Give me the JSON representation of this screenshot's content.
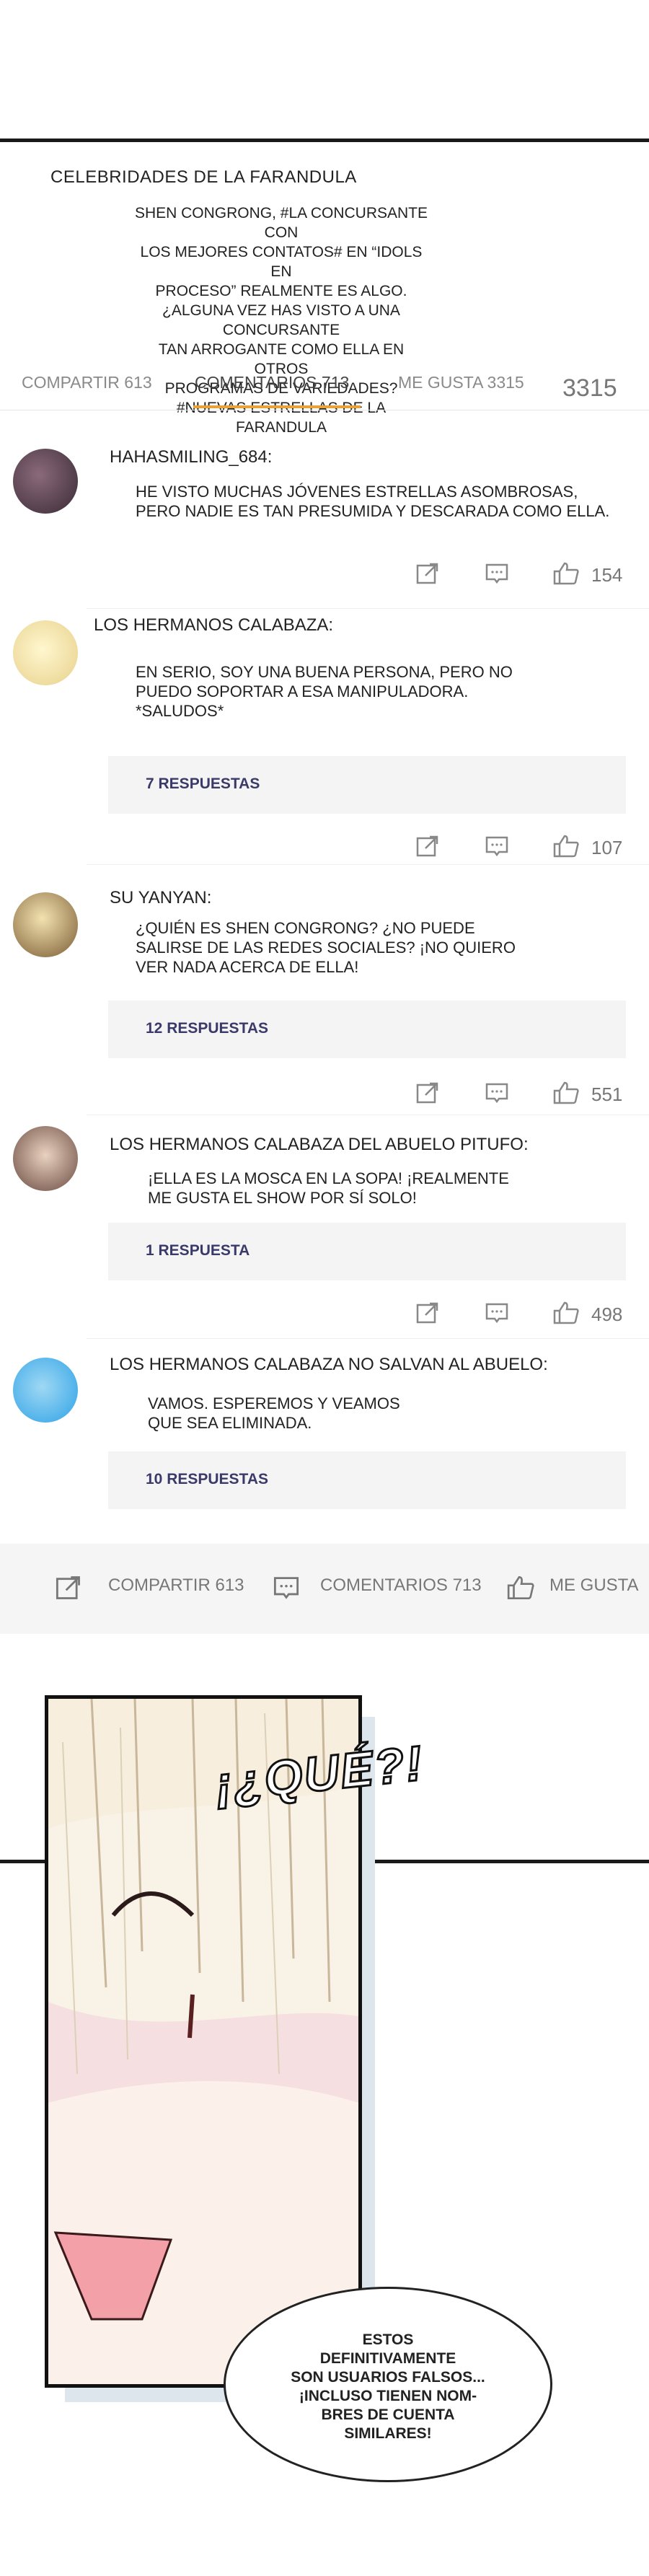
{
  "post": {
    "title": "CELEBRIDADES DE LA FARANDULA",
    "body": "SHEN CONGRONG, #LA CONCURSANTE CON\nLOS MEJORES CONTATOS# EN “IDOLS EN\nPROCESO” REALMENTE ES ALGO.\n¿ALGUNA VEZ HAS VISTO A UNA CONCURSANTE\nTAN ARROGANTE COMO ELLA EN OTROS\nPROGRAMAS DE VARIEDADES?\n#NUEVAS ESTRELLAS DE LA FARANDULA"
  },
  "tabs": [
    {
      "label": "COMPARTIR 613"
    },
    {
      "label": "COMENTARIOS 713"
    },
    {
      "label": "ME GUSTA 3315"
    }
  ],
  "tabs_count": "3315",
  "comments": [
    {
      "user": "HAHASMILING_684:",
      "text": "HE VISTO MUCHAS JÓVENES ESTRELLAS ASOMBROSAS,\nPERO NADIE ES TAN PRESUMIDA Y DESCARADA COMO ELLA.",
      "replies": "",
      "likes": "154"
    },
    {
      "user": "LOS HERMANOS CALABAZA:",
      "text": "EN SERIO, SOY UNA BUENA PERSONA, PERO NO\nPUEDO SOPORTAR A ESA MANIPULADORA.\n*SALUDOS*",
      "replies": "7 RESPUESTAS",
      "likes": "107"
    },
    {
      "user": "SU YANYAN:",
      "text": "¿QUIÉN ES SHEN CONGRONG? ¿NO PUEDE\nSALIRSE DE LAS REDES SOCIALES? ¡NO QUIERO\nVER NADA ACERCA DE ELLA!",
      "replies": "12 RESPUESTAS",
      "likes": "551"
    },
    {
      "user": "LOS HERMANOS CALABAZA DEL ABUELO PITUFO:",
      "text": "¡ELLA ES LA MOSCA EN LA SOPA! ¡REALMENTE\nME GUSTA EL SHOW POR SÍ SOLO!",
      "replies": "1 RESPUESTA",
      "likes": "498"
    },
    {
      "user": "LOS HERMANOS CALABAZA NO SALVAN AL ABUELO:",
      "text": "VAMOS. ESPEREMOS Y VEAMOS\nQUE SEA ELIMINADA.",
      "replies": "10 RESPUESTAS",
      "likes": ""
    }
  ],
  "bottom_bar": {
    "share": "COMPARTIR 613",
    "comments": "COMENTARIOS 713",
    "likes": "ME GUSTA"
  },
  "comic": {
    "sfx": "¡¿QUÉ?!",
    "bubble": "ESTOS\nDEFINITIVAMENTE\nSON USUARIOS FALSOS...\n¡INCLUSO TIENEN NOM-\nBRES DE CUENTA\nSIMILARES!"
  },
  "colors": {
    "accent": "#e8a23a",
    "replies_text": "#3a3a6a"
  },
  "icons": [
    "share-icon",
    "comment-icon",
    "like-icon"
  ]
}
